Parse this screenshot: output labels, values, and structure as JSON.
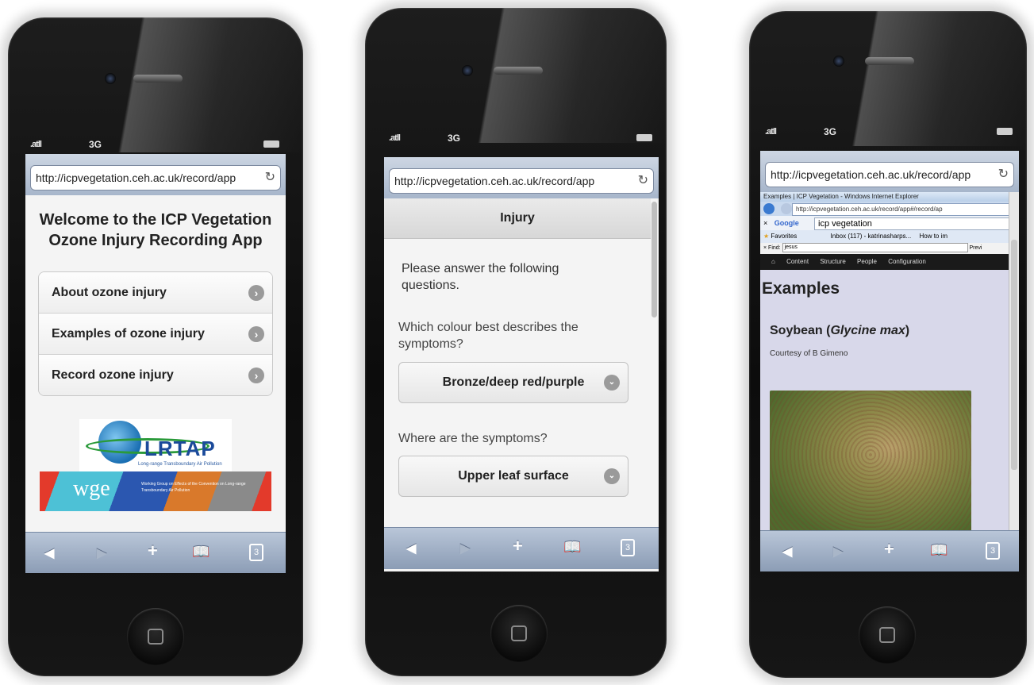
{
  "common": {
    "signal": ".atll",
    "network": "3G",
    "url": "http://icpvegetation.ceh.ac.uk/record/app",
    "reload_icon": "↻",
    "toolbar": {
      "back": "◀",
      "forward": "▶",
      "add": "+",
      "bookmarks": "📖",
      "tabs_count": "3"
    }
  },
  "phone1": {
    "title": "Welcome to the ICP Vegetation Ozone Injury Recording App",
    "menu": [
      {
        "label": "About ozone injury"
      },
      {
        "label": "Examples of ozone injury"
      },
      {
        "label": "Record ozone injury"
      }
    ],
    "arrow_icon": "›",
    "logo_lrtap": "LRTAP",
    "logo_lrtap_sub": "Long-range Transboundary Air Pollution",
    "logo_wge": "wge",
    "logo_wge_sub": "Working Group on Effects of the Convention on Long-range Transboundary Air Pollution"
  },
  "phone2": {
    "header": "Injury",
    "intro": "Please answer the following questions.",
    "q1": "Which colour best describes the symptoms?",
    "q1_value": "Bronze/deep red/purple",
    "q2": "Where are the symptoms?",
    "q2_value": "Upper leaf surface",
    "dropdown_icon": "⌄"
  },
  "phone3": {
    "ie_title": "Examples | ICP Vegetation - Windows Internet Explorer",
    "ie_address": "http://icpvegetation.ceh.ac.uk/record/app#/record/ap",
    "google_label": "Google",
    "google_query": "icp vegetation",
    "favorites": "Favorites",
    "fav_tab1": "Inbox (117) - katrinasharps...",
    "fav_tab2": "How to im",
    "find_label": "Find:",
    "find_value": "jesus",
    "find_prev": "Previ",
    "admin_menu": [
      "Content",
      "Structure",
      "People",
      "Configuration"
    ],
    "heading": "Examples",
    "species_name": "Soybean (",
    "species_latin": "Glycine max",
    "species_close": ")",
    "credit": "Courtesy of B Gimeno"
  }
}
